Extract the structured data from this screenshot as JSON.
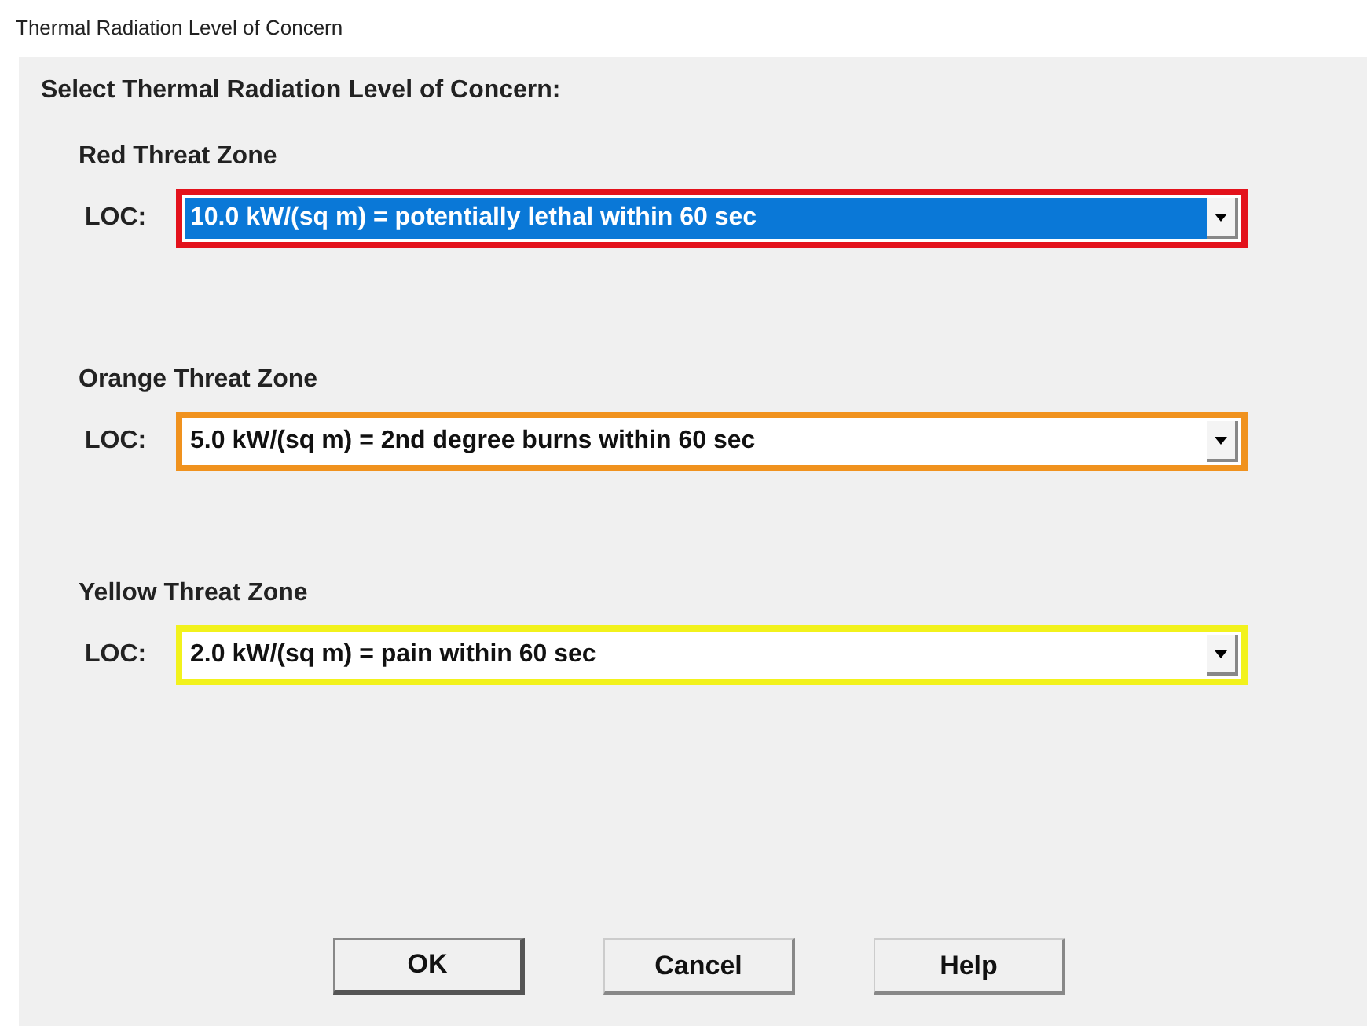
{
  "window": {
    "title": "Thermal Radiation Level of Concern"
  },
  "heading": "Select Thermal Radiation Level of Concern:",
  "zones": [
    {
      "label": "Red Threat Zone",
      "field_label": "LOC:",
      "value": "10.0 kW/(sq m) = potentially lethal within 60 sec",
      "color": "#e3121c",
      "selected": true
    },
    {
      "label": "Orange Threat Zone",
      "field_label": "LOC:",
      "value": "5.0 kW/(sq m) = 2nd degree burns within 60 sec",
      "color": "#f0921e",
      "selected": false
    },
    {
      "label": "Yellow Threat Zone",
      "field_label": "LOC:",
      "value": "2.0 kW/(sq m) = pain within 60 sec",
      "color": "#f2f21c",
      "selected": false
    }
  ],
  "buttons": [
    {
      "label": "OK",
      "default": true
    },
    {
      "label": "Cancel",
      "default": false
    },
    {
      "label": "Help",
      "default": false
    }
  ]
}
